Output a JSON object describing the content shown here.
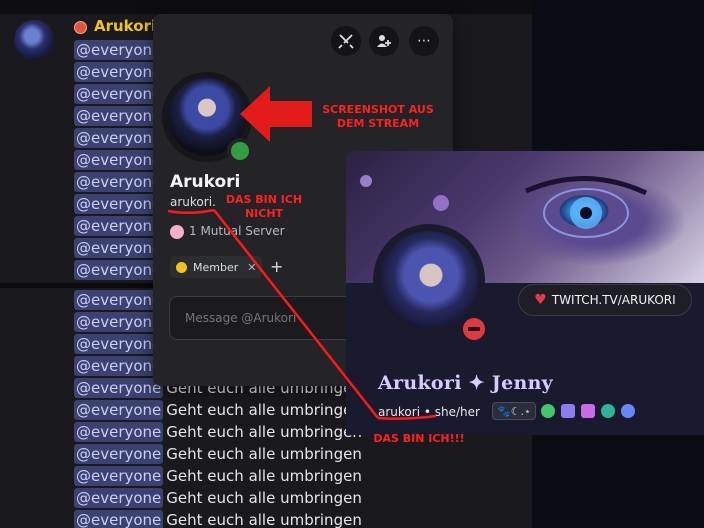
{
  "chat": {
    "author": "Arukori",
    "mention": "@everyone",
    "message": "Geht euch alle umbringen",
    "mention_rows": 23,
    "rows_with_text": 9
  },
  "popout": {
    "display_name": "Arukori",
    "username": "arukori.",
    "mutual_servers": "1 Mutual Server",
    "role": "Member",
    "message_placeholder": "Message @Arukori",
    "buttons": [
      "swords-icon",
      "add-friend-icon",
      "more-icon"
    ],
    "status": "online"
  },
  "profile": {
    "display_name": "Arukori ✦ Jenny",
    "username": "arukori",
    "separator": "•",
    "pronouns": "she/her",
    "twitch_label": "TWITCH.TV/ARUKORI",
    "status": "do-not-disturb",
    "badge_pill": "🐾☾.⋆",
    "badges": [
      "nitro-badge",
      "shield-badge",
      "gem-badge",
      "hashtag-badge",
      "gear-badge"
    ]
  },
  "annotations": {
    "screenshot": "SCREENSHOT AUS DEM STREAM",
    "not_me": "DAS BIN ICH NICHT",
    "me": "DAS BIN ICH!!!"
  },
  "colors": {
    "author": "#f0c419",
    "mention_bg": "#3c4270",
    "online": "#2ea043",
    "dnd": "#e03a3e",
    "annotation": "#ff2020"
  }
}
